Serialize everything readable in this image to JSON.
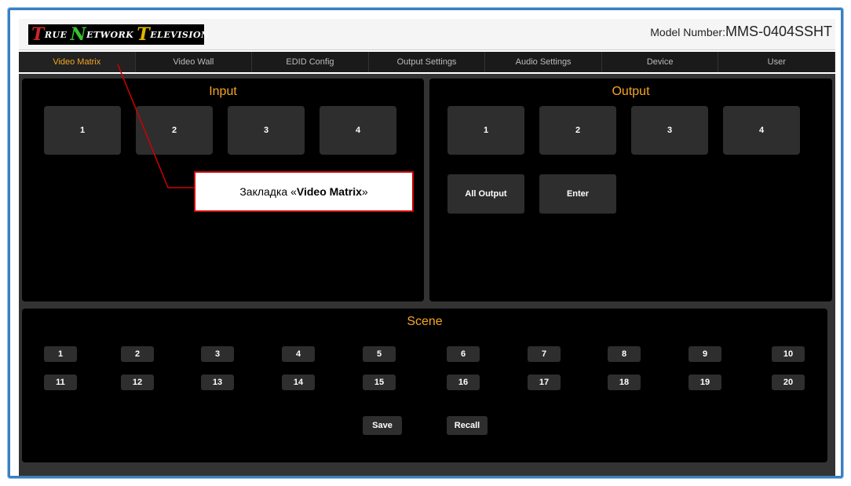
{
  "header": {
    "logo": [
      {
        "big": "T",
        "small": "RUE"
      },
      {
        "big": "N",
        "small": "ETWORK"
      },
      {
        "big": "T",
        "small": "ELEVISION"
      }
    ],
    "model_label": "Model Number:",
    "model_value": "MMS-0404SSHT"
  },
  "nav": {
    "tabs": [
      "Video Matrix",
      "Video Wall",
      "EDID Config",
      "Output Settings",
      "Audio Settings",
      "Device",
      "User"
    ],
    "active": "Video Matrix"
  },
  "input": {
    "title": "Input",
    "buttons": [
      "1",
      "2",
      "3",
      "4"
    ]
  },
  "output": {
    "title": "Output",
    "buttons": [
      "1",
      "2",
      "3",
      "4"
    ],
    "all_output": "All Output",
    "enter": "Enter"
  },
  "scene": {
    "title": "Scene",
    "row1": [
      "1",
      "2",
      "3",
      "4",
      "5",
      "6",
      "7",
      "8",
      "9",
      "10"
    ],
    "row2": [
      "11",
      "12",
      "13",
      "14",
      "15",
      "16",
      "17",
      "18",
      "19",
      "20"
    ],
    "save": "Save",
    "recall": "Recall"
  },
  "callout": {
    "prefix": "Закладка «",
    "bold": "Video Matrix",
    "suffix": "»"
  },
  "colors": {
    "accent": "#f5a623",
    "frame": "#3a7fc1",
    "callout_border": "#cc0000"
  }
}
